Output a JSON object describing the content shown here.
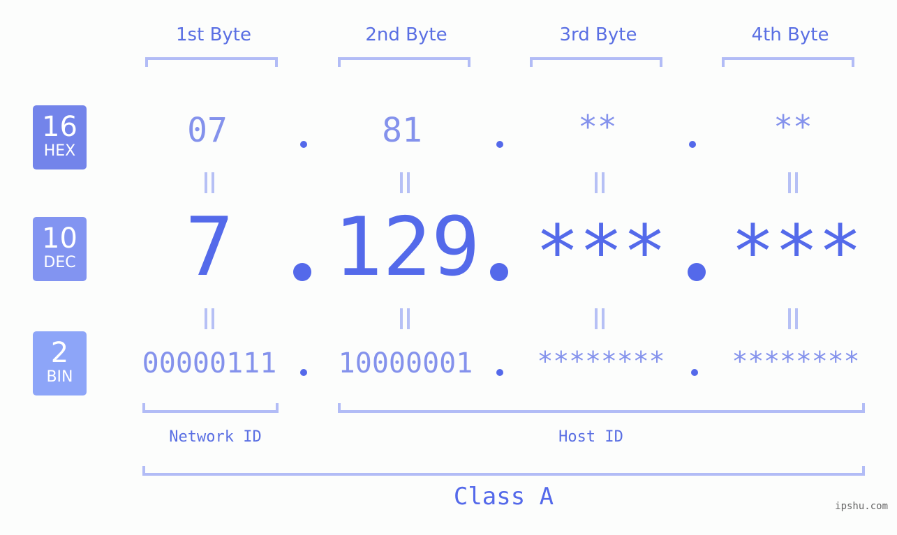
{
  "bases": {
    "hex": {
      "number": "16",
      "label": "HEX"
    },
    "dec": {
      "number": "10",
      "label": "DEC"
    },
    "bin": {
      "number": "2",
      "label": "BIN"
    }
  },
  "bytes": [
    {
      "header": "1st Byte",
      "hex": "07",
      "dec": "7",
      "bin": "00000111"
    },
    {
      "header": "2nd Byte",
      "hex": "81",
      "dec": "129",
      "bin": "10000001"
    },
    {
      "header": "3rd Byte",
      "hex": "**",
      "dec": "***",
      "bin": "********"
    },
    {
      "header": "4th Byte",
      "hex": "**",
      "dec": "***",
      "bin": "********"
    }
  ],
  "segments": {
    "network_id": "Network ID",
    "host_id": "Host ID"
  },
  "ip_class": "Class A",
  "watermark": "ipshu.com",
  "colors": {
    "primary": "#5469ea",
    "light": "#8492ec",
    "bracket": "#b2bcf6",
    "hex_badge": "#7384ea",
    "dec_badge": "#8294f1",
    "bin_badge": "#8da5f8"
  }
}
